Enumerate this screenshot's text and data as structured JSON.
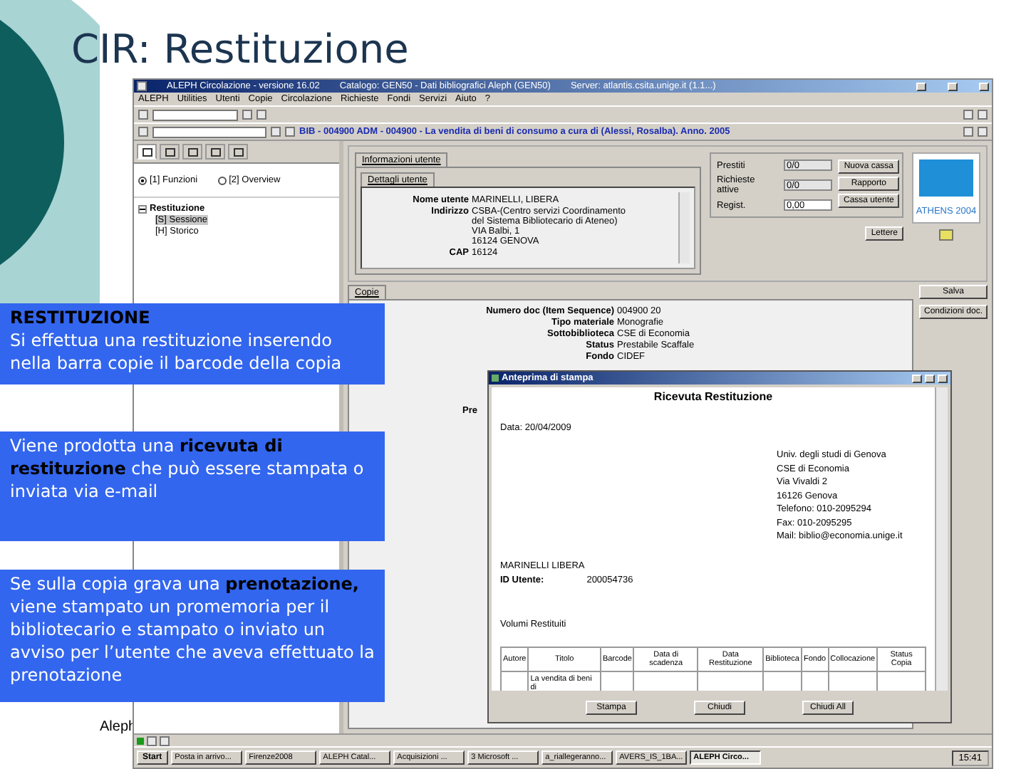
{
  "slide": {
    "title": "CIR: Restituzione",
    "footer": "Aleph"
  },
  "app": {
    "title": "ALEPH Circolazione - versione 16.02",
    "catalog": "Catalogo: GEN50 - Dati bibliografici Aleph (GEN50)",
    "server": "Server: atlantis.csita.unige.it (1.1...)",
    "menu": [
      "ALEPH",
      "Utilities",
      "Utenti",
      "Copie",
      "Circolazione",
      "Richieste",
      "Fondi",
      "Servizi",
      "Aiuto",
      "?"
    ],
    "record": "BIB - 004900 ADM - 004900 - La vendita di beni di consumo a cura di (Alessi, Rosalba). Anno. 2005",
    "left_tabs": [
      {
        "selected": true
      },
      {
        "selected": false
      },
      {
        "selected": false
      },
      {
        "selected": false
      },
      {
        "selected": false
      }
    ],
    "modes": [
      {
        "label": "[1] Funzioni",
        "selected": true
      },
      {
        "label": "[2] Overview",
        "selected": false
      }
    ],
    "tree": [
      {
        "label": "Restituzione",
        "expanded": true,
        "selected": false,
        "children": [
          {
            "label": "[S] Sessione",
            "selected": true
          },
          {
            "label": "[H] Storico",
            "selected": false
          }
        ]
      }
    ],
    "user_tabs": [
      {
        "label": "Informazioni utente",
        "selected": true
      }
    ],
    "user_subtabs": [
      {
        "label": "Dettagli utente",
        "selected": true
      }
    ],
    "user_fields": [
      {
        "label": "Nome utente",
        "lines": [
          "MARINELLI, LIBERA"
        ]
      },
      {
        "label": "Indirizzo",
        "lines": [
          "CSBA-(Centro servizi Coordinamento",
          "del Sistema Bibliotecario di Ateneo)",
          "VIA Balbi, 1",
          "16124 GENOVA"
        ]
      },
      {
        "label": "CAP",
        "lines": [
          "16124"
        ]
      }
    ],
    "counters": [
      {
        "label": "Prestiti",
        "value": "0/0"
      },
      {
        "label": "Richieste attive",
        "value": "0/0"
      },
      {
        "label": "Regist.",
        "value": "0,00"
      }
    ],
    "user_buttons": [
      "Nuova cassa",
      "Rapporto",
      "Cassa utente"
    ],
    "logo": "ATHENS 2004",
    "letters_button": "Lettere",
    "copy_tabs": [
      {
        "label": "Copie",
        "selected": true
      }
    ],
    "copy_fields": [
      {
        "label": "Numero doc (Item Sequence)",
        "value": "004900 20"
      },
      {
        "label": "Tipo materiale",
        "value": "Monografie"
      },
      {
        "label": "Sottobiblioteca",
        "value": "CSE di Economia"
      },
      {
        "label": "Status",
        "value": "Prestabile Scaffale"
      },
      {
        "label": "Fondo",
        "value": "CIDEF"
      }
    ],
    "copy_note": "Pre",
    "copy_buttons": [
      "Salva",
      "Condizioni doc."
    ]
  },
  "taskbar": {
    "start": "Start",
    "items": [
      {
        "label": "Posta in arrivo...",
        "selected": false
      },
      {
        "label": "Firenze2008",
        "selected": false
      },
      {
        "label": "ALEPH Catal...",
        "selected": false
      },
      {
        "label": "Acquisizioni ...",
        "selected": false
      },
      {
        "label": "3 Microsoft ...",
        "selected": false
      },
      {
        "label": "a_riallegeranno...",
        "selected": false
      },
      {
        "label": "AVERS_IS_1BA...",
        "selected": false
      },
      {
        "label": "ALEPH Circo...",
        "selected": true
      }
    ],
    "clock": "15:41"
  },
  "dialog": {
    "title": "Anteprima di stampa",
    "heading": "Ricevuta Restituzione",
    "date": "Data: 20/04/2009",
    "address": [
      "Univ. degli studi di Genova",
      "CSE di Economia",
      "Via Vivaldi 2",
      "16126 Genova",
      "Telefono: 010-2095294",
      "Fax: 010-2095295",
      "Mail: biblio@economia.unige.it"
    ],
    "user_name": "MARINELLI LIBERA",
    "id_label": "ID Utente:",
    "id_value": "200054736",
    "section": "Volumi Restituiti",
    "columns": [
      "Autore",
      "Titolo",
      "Barcode",
      "Data di scadenza",
      "Data Restituzione",
      "Biblioteca",
      "Fondo",
      "Collocazione",
      "Status Copia"
    ],
    "rows": [
      {
        "cells": {
          "1": "La vendita di beni di"
        }
      }
    ],
    "buttons": [
      "Stampa",
      "Chiudi",
      "Chiudi All"
    ]
  },
  "callouts": [
    {
      "title": "RESTITUZIONE",
      "text": "Si effettua una restituzione inserendo nella barra copie il barcode della copia"
    },
    {
      "text": "Viene prodotta una **ricevuta di restituzione** che può essere stampata o inviata via e-mail"
    },
    {
      "text": "Se sulla copia grava una **prenotazione,** viene stampato un promemoria per il bibliotecario e stampato o inviato un avviso per l’utente che aveva effettuato la prenotazione"
    }
  ]
}
